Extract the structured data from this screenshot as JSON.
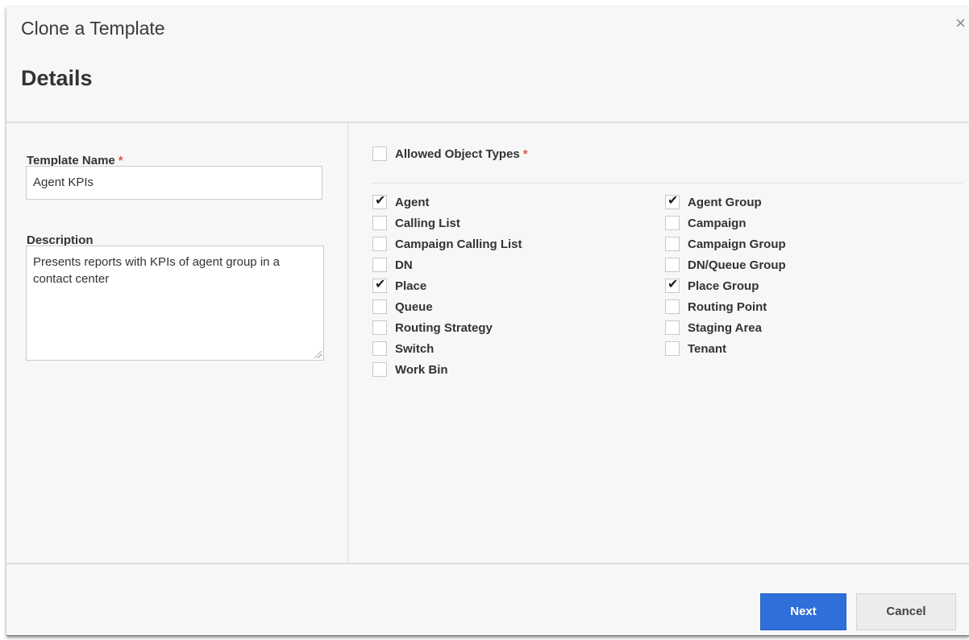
{
  "dialog": {
    "title": "Clone a Template",
    "close_glyph": "×",
    "section_title": "Details"
  },
  "form": {
    "template_name": {
      "label": "Template Name",
      "required_mark": "*",
      "value": "Agent KPIs"
    },
    "description": {
      "label": "Description",
      "value": "Presents reports with KPIs of agent group in a contact center"
    }
  },
  "object_types": {
    "label": "Allowed Object Types",
    "required_mark": "*",
    "select_all_checked": false,
    "left_column": [
      {
        "label": "Agent",
        "checked": true
      },
      {
        "label": "Calling List",
        "checked": false
      },
      {
        "label": "Campaign Calling List",
        "checked": false
      },
      {
        "label": "DN",
        "checked": false
      },
      {
        "label": "Place",
        "checked": true
      },
      {
        "label": "Queue",
        "checked": false
      },
      {
        "label": "Routing Strategy",
        "checked": false
      },
      {
        "label": "Switch",
        "checked": false
      },
      {
        "label": "Work Bin",
        "checked": false
      }
    ],
    "right_column": [
      {
        "label": "Agent Group",
        "checked": true
      },
      {
        "label": "Campaign",
        "checked": false
      },
      {
        "label": "Campaign Group",
        "checked": false
      },
      {
        "label": "DN/Queue Group",
        "checked": false
      },
      {
        "label": "Place Group",
        "checked": true
      },
      {
        "label": "Routing Point",
        "checked": false
      },
      {
        "label": "Staging Area",
        "checked": false
      },
      {
        "label": "Tenant",
        "checked": false
      }
    ]
  },
  "footer": {
    "next_label": "Next",
    "cancel_label": "Cancel"
  },
  "colors": {
    "primary_button": "#2e6fd9",
    "required_asterisk": "#d9534f",
    "dialog_background": "#f7f7f7"
  },
  "icons": {
    "close": "close-icon",
    "check": "checkmark-icon",
    "resize": "resize-grip-icon"
  }
}
